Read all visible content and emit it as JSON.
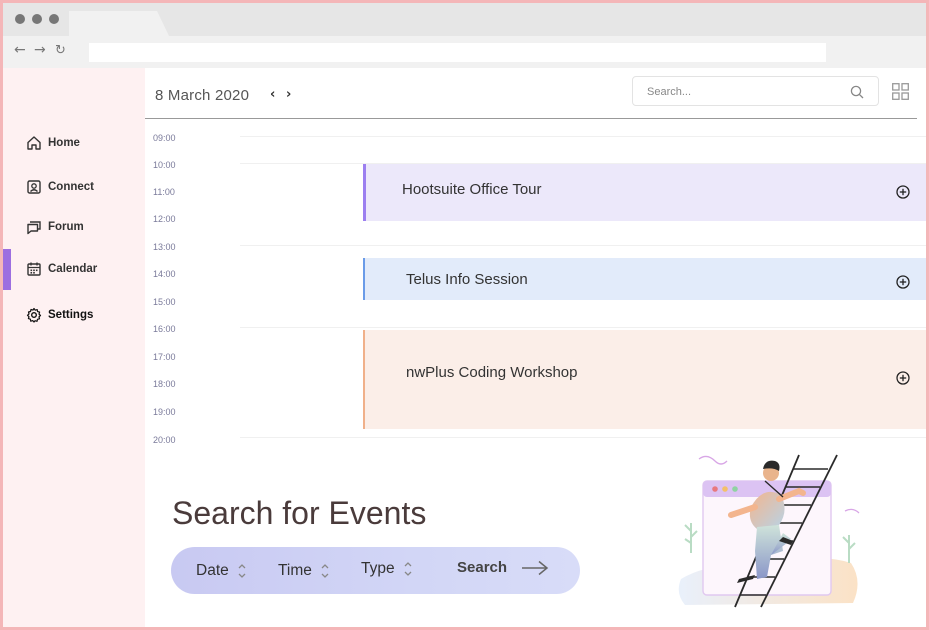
{
  "header": {
    "date": "8 March 2020",
    "prev_label": "‹",
    "next_label": "›",
    "search_placeholder": "Search..."
  },
  "sidebar": {
    "items": [
      {
        "label": "Home",
        "icon": "home-icon"
      },
      {
        "label": "Connect",
        "icon": "contact-icon"
      },
      {
        "label": "Forum",
        "icon": "chat-icon"
      },
      {
        "label": "Calendar",
        "icon": "calendar-icon",
        "active": true
      },
      {
        "label": "Settings",
        "icon": "gear-icon"
      }
    ]
  },
  "timeline": {
    "times": [
      "09:00",
      "10:00",
      "11:00",
      "12:00",
      "13:00",
      "14:00",
      "15:00",
      "16:00",
      "17:00",
      "18:00",
      "19:00",
      "20:00"
    ]
  },
  "events": [
    {
      "title": "Hootsuite Office Tour",
      "bg": "#ece8fa",
      "accent": "#9c7ff0"
    },
    {
      "title": "Telus Info Session",
      "bg": "#e2ebfa",
      "accent": "#6a9be8"
    },
    {
      "title": "nwPlus Coding Workshop",
      "bg": "#fbeee8",
      "accent": "#f0b08a"
    }
  ],
  "search_section": {
    "heading": "Search for Events",
    "filters": [
      "Date",
      "Time",
      "Type"
    ],
    "button_label": "Search"
  },
  "colors": {
    "sidebar_bg": "#fef1f2",
    "active_accent": "#9c6ee0",
    "frame_border": "#f4b6b8"
  }
}
